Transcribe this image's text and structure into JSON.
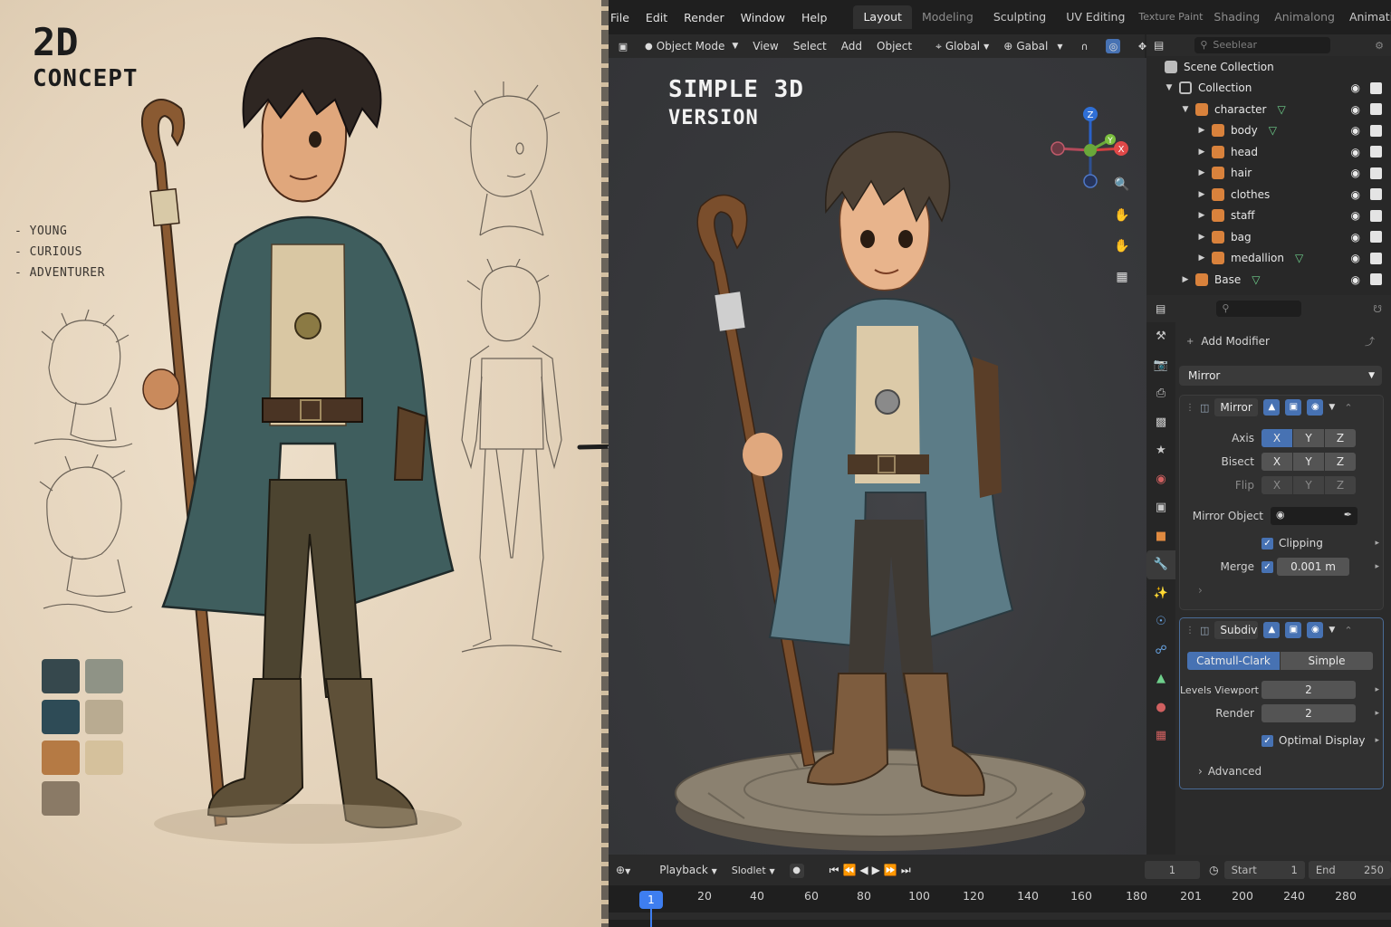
{
  "concept": {
    "title_line1": "2D",
    "title_line2": "CONCEPT",
    "traits": [
      "- YOUNG",
      "- CURIOUS",
      "- ADVENTURER"
    ],
    "palette": [
      "#36484d",
      "#8f9386",
      "#2e4b56",
      "#b9ab91",
      "#b57a44",
      "#d5c19c",
      "#8a7a66"
    ]
  },
  "menubar": {
    "items": [
      "File",
      "Edit",
      "Render",
      "Window",
      "Help"
    ],
    "workspaces": [
      "Layout",
      "Modeling",
      "Sculpting",
      "UV Editing",
      "Texture Paint",
      "Shading",
      "Animalong",
      "Animation"
    ],
    "active_workspace": "Layout"
  },
  "viewport_header": {
    "mode": "Object Mode",
    "menus": [
      "View",
      "Select",
      "Add",
      "Object"
    ],
    "orientation": "Global",
    "pivot": "Gabal"
  },
  "viewport": {
    "title_line1": "SIMPLE 3D",
    "title_line2": "VERSION",
    "gizmo": {
      "z": "Z",
      "y": "Y",
      "x": "X"
    }
  },
  "outliner": {
    "search_placeholder": "Seeblear",
    "scene_collection": "Scene Collection",
    "rows": [
      {
        "name": "Collection",
        "depth": 0,
        "icon": "collection-icon",
        "expanded": true
      },
      {
        "name": "character",
        "depth": 1,
        "icon": "object-icon",
        "expanded": true,
        "modifier": true
      },
      {
        "name": "body",
        "depth": 2,
        "icon": "object-icon",
        "modifier": true
      },
      {
        "name": "head",
        "depth": 2,
        "icon": "object-icon"
      },
      {
        "name": "hair",
        "depth": 2,
        "icon": "object-icon"
      },
      {
        "name": "clothes",
        "depth": 2,
        "icon": "object-icon"
      },
      {
        "name": "staff",
        "depth": 2,
        "icon": "object-icon"
      },
      {
        "name": "bag",
        "depth": 2,
        "icon": "object-icon"
      },
      {
        "name": "medallion",
        "depth": 2,
        "icon": "object-icon",
        "modifier": true
      },
      {
        "name": "Base",
        "depth": 1,
        "icon": "object-icon",
        "modifier": true
      }
    ]
  },
  "properties": {
    "add_modifier_label": "Add Modifier",
    "dropdown_value": "Mirror",
    "mirror": {
      "name": "Mirror",
      "axis_label": "Axis",
      "bisect_label": "Bisect",
      "flip_label": "Flip",
      "axes": [
        "X",
        "Y",
        "Z"
      ],
      "mirror_object_label": "Mirror Object",
      "clipping_label": "Clipping",
      "merge_label": "Merge",
      "merge_value": "0.001 m"
    },
    "subdivision": {
      "name": "Subdivi",
      "type_options": [
        "Catmull-Clark",
        "Simple"
      ],
      "levels_viewport_label": "Levels Viewport",
      "levels_viewport_value": "2",
      "render_label": "Render",
      "render_value": "2",
      "optimal_display_label": "Optimal Display",
      "advanced_label": "Advanced"
    }
  },
  "timeline": {
    "playback_label": "Playback",
    "keying_label": "Slodlet",
    "current_frame": "1",
    "start_label": "Start",
    "start_value": "1",
    "end_label": "End",
    "end_value": "250",
    "ruler_current": "1",
    "ruler_ticks": [
      "20",
      "40",
      "60",
      "80",
      "100",
      "120",
      "140",
      "160",
      "180",
      "201",
      "200",
      "240",
      "280"
    ]
  }
}
